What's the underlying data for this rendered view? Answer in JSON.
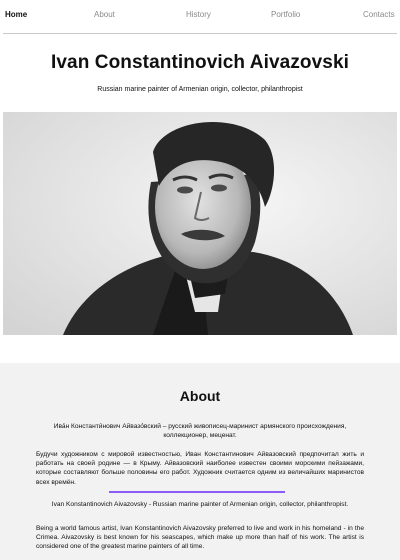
{
  "nav": {
    "items": [
      "Home",
      "About",
      "History",
      "Portfolio",
      "Contacts"
    ],
    "active": "Home"
  },
  "hero": {
    "title": "Ivan Constantinovich Aivazovski",
    "subtitle": "Russian marine painter of Armenian origin, collector, philanthropist",
    "portrait_alt": "Engraved portrait of Ivan Aivazovski"
  },
  "about": {
    "title": "About",
    "ru_intro": "Ива́н Константи́нович Айвазо́вский – русский живописец-маринист армянского происхождения, коллекционер, меценат.",
    "ru_body": "Будучи художником с мировой известностью, Иван Константинович Айвазовский предпочитал жить и работать на своей родине — в Крыму. Айвазовский наиболее известен своими морскими пейзажами, которые составляют больше половины его работ. Художник считается одним из величайших маринистов всех времён.",
    "en_intro": "Ivan Konstantinovich Aivazovsky - Russian marine painter of Armenian origin, collector, philanthropist.",
    "en_body": "Being a world famous artist, Ivan Konstantinovich Aivazovsky preferred to live and work in his homeland - in the Crimea. Aivazovsky is best known for his seascapes, which make up more than half of his work. The artist is considered one of the greatest marine painters of all time."
  },
  "colors": {
    "accent": "#8b5cf6",
    "section_bg": "#f2f2f2",
    "nav_inactive": "#8a8a8a"
  }
}
